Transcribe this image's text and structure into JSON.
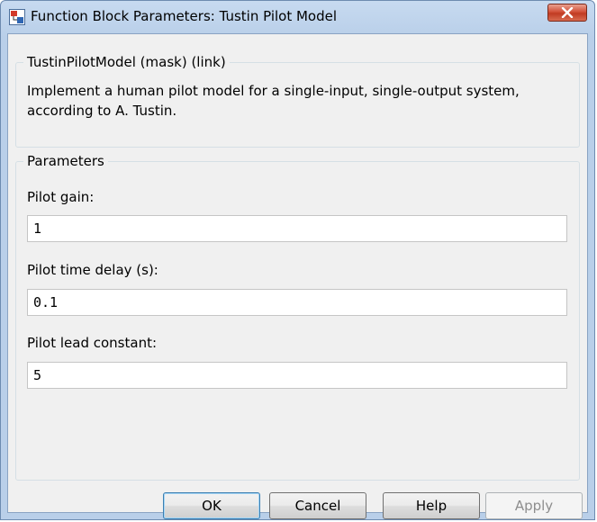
{
  "window": {
    "title": "Function Block Parameters: Tustin Pilot Model"
  },
  "block": {
    "header": "TustinPilotModel (mask) (link)",
    "description": "Implement a human pilot model for a single-input, single-output system, according to A. Tustin."
  },
  "parameters": {
    "legend": "Parameters",
    "fields": [
      {
        "label": "Pilot gain:",
        "value": "1"
      },
      {
        "label": "Pilot time delay (s):",
        "value": "0.1"
      },
      {
        "label": "Pilot lead constant:",
        "value": "5"
      }
    ]
  },
  "buttons": {
    "ok": "OK",
    "cancel": "Cancel",
    "help": "Help",
    "apply": "Apply"
  },
  "icons": {
    "app": "simulink-block-icon",
    "close": "close-icon"
  },
  "colors": {
    "title_bar": "#b9cfe9",
    "client_bg": "#f0f0f0",
    "close_button": "#c94a31",
    "default_button_border": "#3c7fb1"
  }
}
